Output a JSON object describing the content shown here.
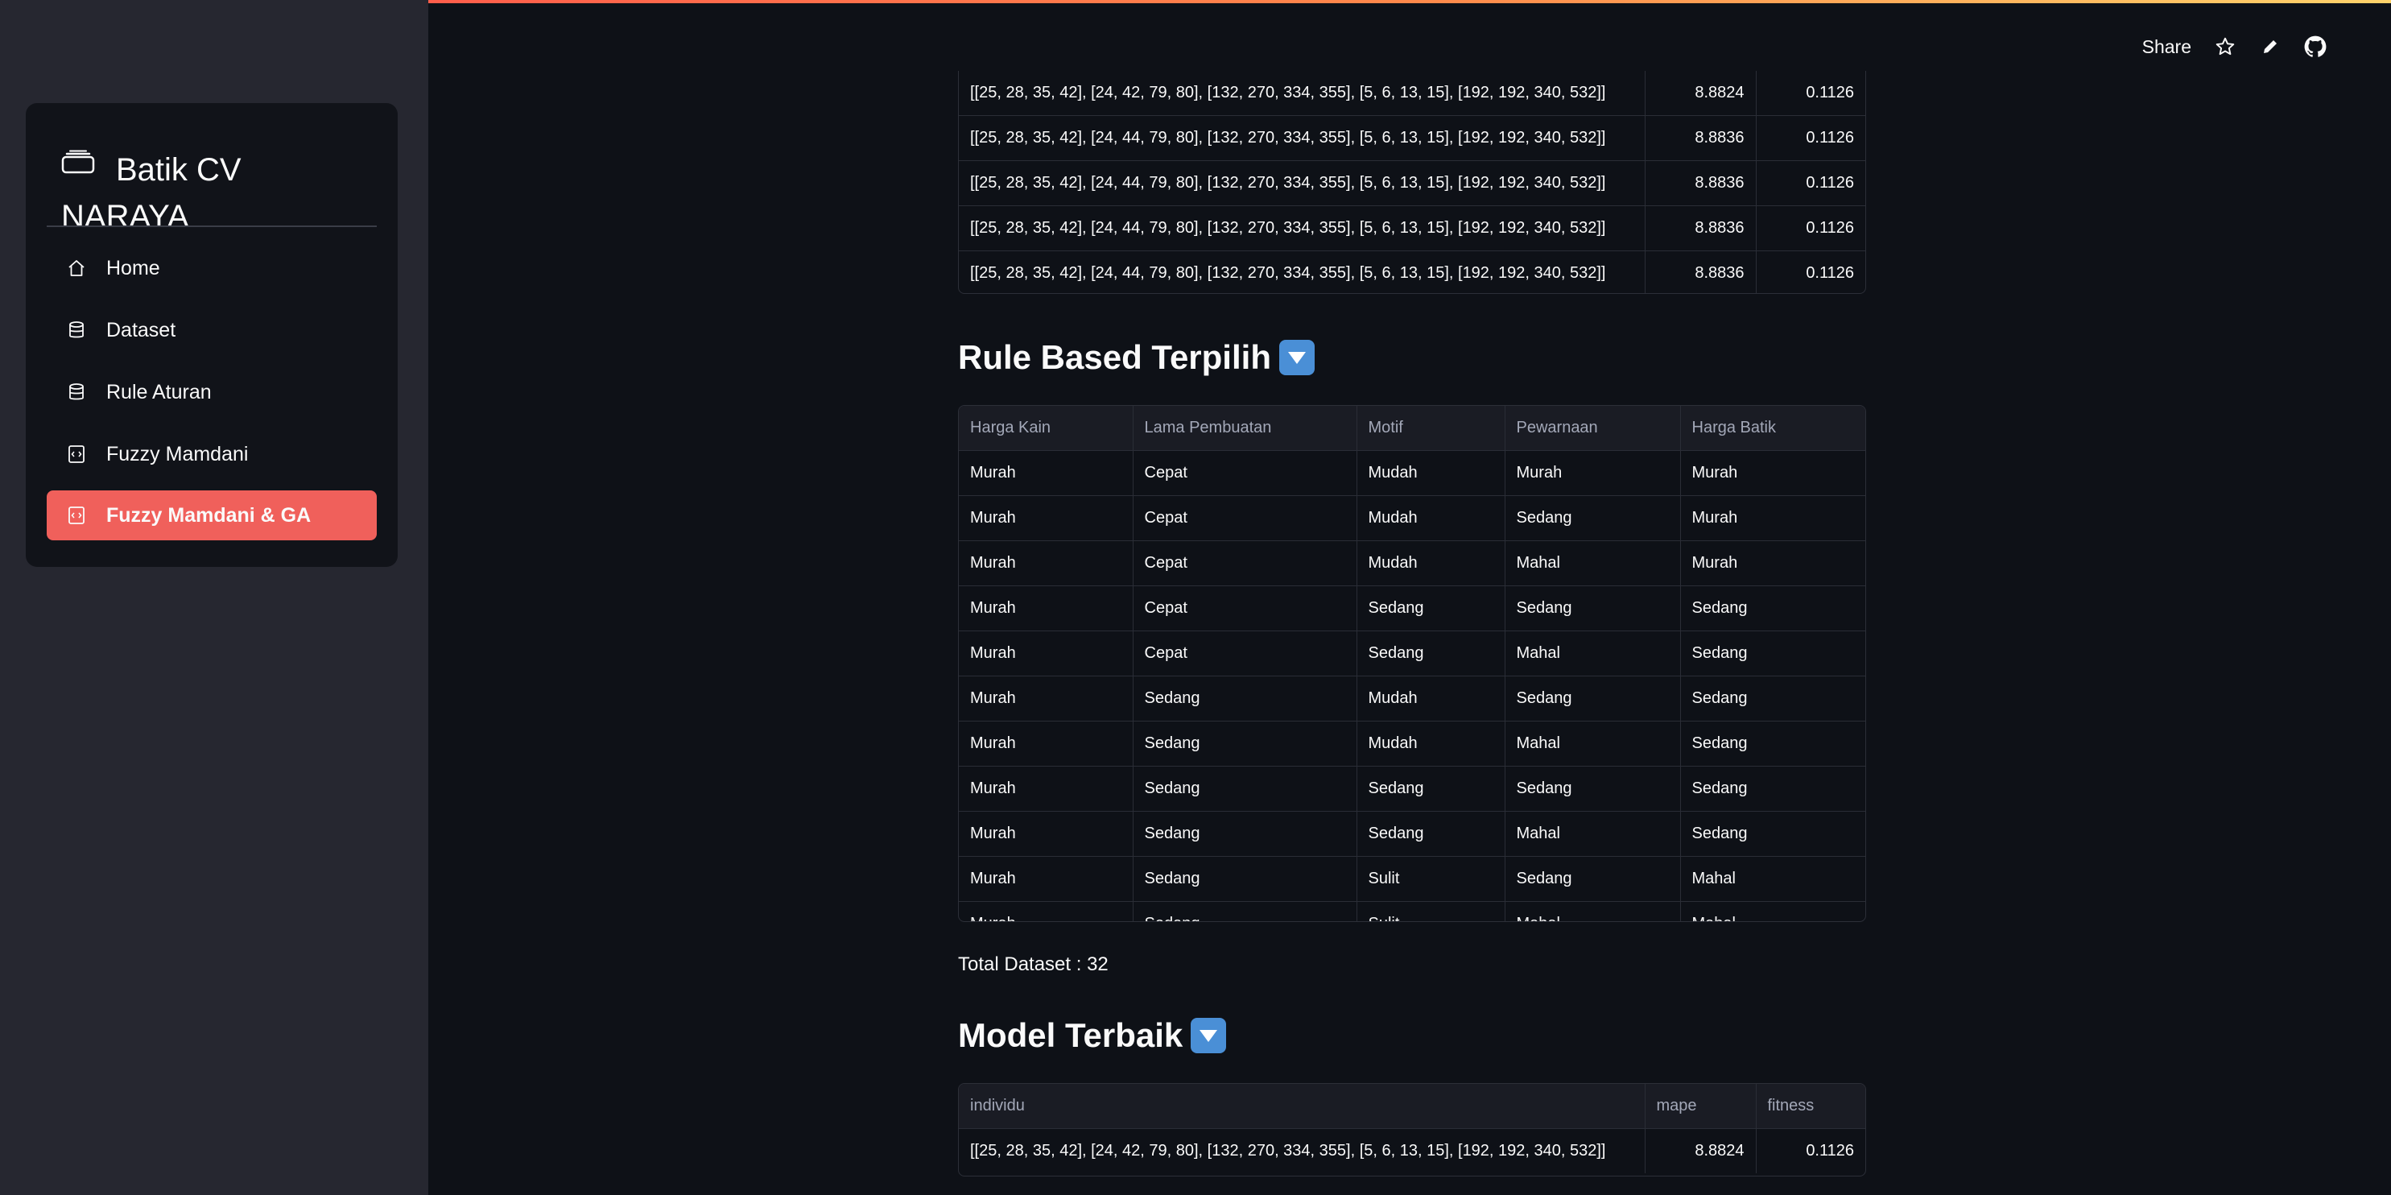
{
  "header": {
    "share_label": "Share"
  },
  "sidebar": {
    "brand": "Batik CV NARAYA",
    "items": [
      {
        "label": "Home",
        "icon": "home-icon",
        "active": false
      },
      {
        "label": "Dataset",
        "icon": "database-icon",
        "active": false
      },
      {
        "label": "Rule Aturan",
        "icon": "database-icon",
        "active": false
      },
      {
        "label": "Fuzzy Mamdani",
        "icon": "code-file-icon",
        "active": false
      },
      {
        "label": "Fuzzy Mamdani & GA",
        "icon": "code-file-icon",
        "active": true
      }
    ]
  },
  "top_table": {
    "rows": [
      {
        "individu": "[[25, 28, 35, 42], [24, 42, 79, 80], [132, 270, 334, 355], [5, 6, 13, 15], [192, 192, 340, 532]]",
        "mape": "8.8824",
        "fitness": "0.1126"
      },
      {
        "individu": "[[25, 28, 35, 42], [24, 44, 79, 80], [132, 270, 334, 355], [5, 6, 13, 15], [192, 192, 340, 532]]",
        "mape": "8.8836",
        "fitness": "0.1126"
      },
      {
        "individu": "[[25, 28, 35, 42], [24, 44, 79, 80], [132, 270, 334, 355], [5, 6, 13, 15], [192, 192, 340, 532]]",
        "mape": "8.8836",
        "fitness": "0.1126"
      },
      {
        "individu": "[[25, 28, 35, 42], [24, 44, 79, 80], [132, 270, 334, 355], [5, 6, 13, 15], [192, 192, 340, 532]]",
        "mape": "8.8836",
        "fitness": "0.1126"
      },
      {
        "individu": "[[25, 28, 35, 42], [24, 44, 79, 80], [132, 270, 334, 355], [5, 6, 13, 15], [192, 192, 340, 532]]",
        "mape": "8.8836",
        "fitness": "0.1126"
      }
    ]
  },
  "rule_section": {
    "title": "Rule Based Terpilih",
    "columns": [
      "Harga Kain",
      "Lama Pembuatan",
      "Motif",
      "Pewarnaan",
      "Harga Batik"
    ],
    "rows": [
      [
        "Murah",
        "Cepat",
        "Mudah",
        "Murah",
        "Murah"
      ],
      [
        "Murah",
        "Cepat",
        "Mudah",
        "Sedang",
        "Murah"
      ],
      [
        "Murah",
        "Cepat",
        "Mudah",
        "Mahal",
        "Murah"
      ],
      [
        "Murah",
        "Cepat",
        "Sedang",
        "Sedang",
        "Sedang"
      ],
      [
        "Murah",
        "Cepat",
        "Sedang",
        "Mahal",
        "Sedang"
      ],
      [
        "Murah",
        "Sedang",
        "Mudah",
        "Sedang",
        "Sedang"
      ],
      [
        "Murah",
        "Sedang",
        "Mudah",
        "Mahal",
        "Sedang"
      ],
      [
        "Murah",
        "Sedang",
        "Sedang",
        "Sedang",
        "Sedang"
      ],
      [
        "Murah",
        "Sedang",
        "Sedang",
        "Mahal",
        "Sedang"
      ],
      [
        "Murah",
        "Sedang",
        "Sulit",
        "Sedang",
        "Mahal"
      ],
      [
        "Murah",
        "Sedang",
        "Sulit",
        "Mahal",
        "Mahal"
      ]
    ],
    "total_text": "Total Dataset : 32"
  },
  "model_section": {
    "title": "Model Terbaik",
    "columns": [
      "individu",
      "mape",
      "fitness"
    ],
    "rows": [
      {
        "individu": "[[25, 28, 35, 42], [24, 42, 79, 80], [132, 270, 334, 355], [5, 6, 13, 15], [192, 192, 340, 532]]",
        "mape": "8.8824",
        "fitness": "0.1126"
      }
    ]
  },
  "colors": {
    "accent": "#f0605b",
    "background": "#0e1117",
    "sidebar": "#262730",
    "badge": "#4a8fd6"
  }
}
